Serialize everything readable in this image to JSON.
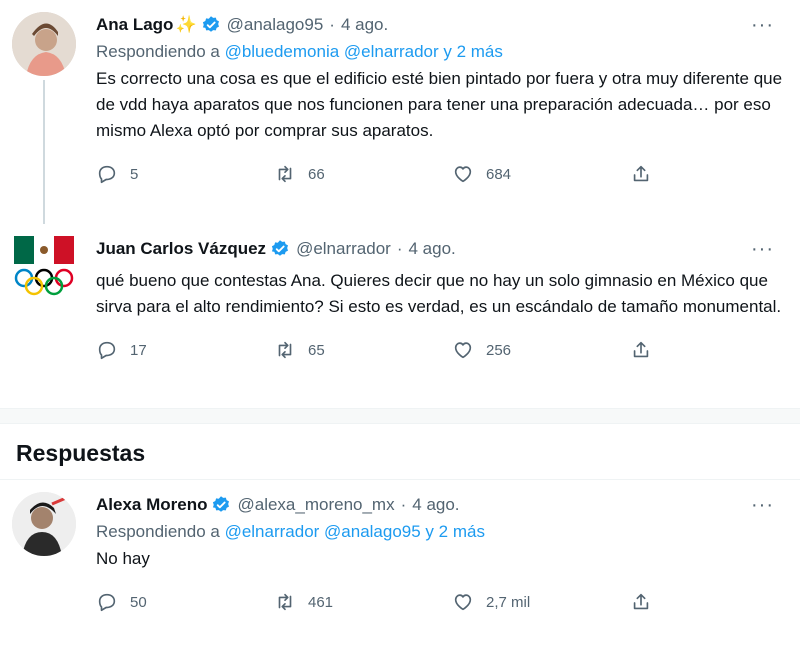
{
  "tweets": [
    {
      "name": "Ana Lago",
      "emoji": "✨",
      "handle": "@analago95",
      "sep": "·",
      "date": "4 ago.",
      "replying_prefix": "Respondiendo a",
      "replying_links": "@bluedemonia @elnarrador y 2 más",
      "text": "Es correcto una cosa es que el edificio esté bien pintado por fuera y otra muy diferente que de vdd haya aparatos que nos funcionen para tener una preparación adecuada… por eso mismo Alexa optó por comprar sus aparatos.",
      "replies": "5",
      "retweets": "66",
      "likes": "684"
    },
    {
      "name": "Juan Carlos Vázquez",
      "handle": "@elnarrador",
      "sep": "·",
      "date": "4 ago.",
      "text": "qué bueno que contestas Ana. Quieres decir que no hay un solo gimnasio en México que sirva para el alto rendimiento? Si esto es verdad, es un escándalo de tamaño monumental.",
      "replies": "17",
      "retweets": "65",
      "likes": "256"
    },
    {
      "name": "Alexa Moreno",
      "handle": "@alexa_moreno_mx",
      "sep": "·",
      "date": "4 ago.",
      "replying_prefix": "Respondiendo a",
      "replying_links": "@elnarrador @analago95 y 2 más",
      "text": "No hay",
      "replies": "50",
      "retweets": "461",
      "likes": "2,7 mil"
    }
  ],
  "section_title": "Respuestas",
  "more_glyph": "···",
  "colors": {
    "accent": "#1d9bf0",
    "muted": "#536471",
    "text": "#0f1419"
  }
}
